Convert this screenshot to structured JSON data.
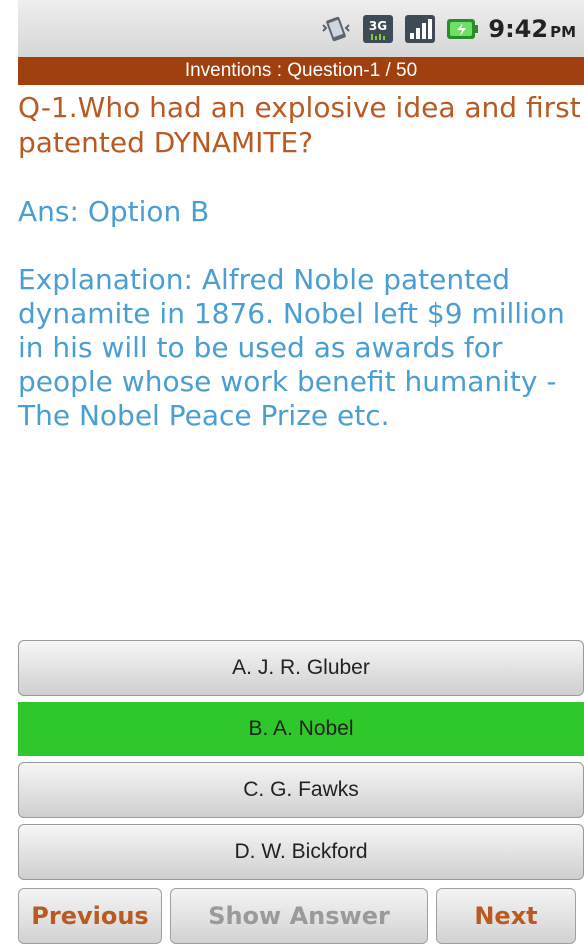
{
  "status_bar": {
    "time": "9:42",
    "ampm": "PM",
    "icons": [
      "vibrate-icon",
      "3g-icon",
      "signal-icon",
      "battery-charging-icon"
    ]
  },
  "header": {
    "title": "Inventions : Question-1 / 50"
  },
  "question": {
    "text": "Q-1.Who had an explosive idea and first patented DYNAMITE?"
  },
  "answer": {
    "text": "Ans: Option B"
  },
  "explanation": {
    "text": "Explanation: Alfred Noble patented dynamite in 1876. Nobel left $9 million in his will to be used as awards for people whose work benefit humanity - The Nobel Peace Prize etc."
  },
  "options": [
    {
      "label": "A. J. R. Gluber",
      "selected": false
    },
    {
      "label": "B. A. Nobel",
      "selected": true
    },
    {
      "label": "C. G. Fawks",
      "selected": false
    },
    {
      "label": "D. W. Bickford",
      "selected": false
    }
  ],
  "nav": {
    "previous": "Previous",
    "show_answer": "Show Answer",
    "next": "Next"
  },
  "colors": {
    "header_bg": "#a0400f",
    "question_text": "#b85a21",
    "answer_text": "#4a9fd2",
    "selected_option": "#2ec82a"
  }
}
